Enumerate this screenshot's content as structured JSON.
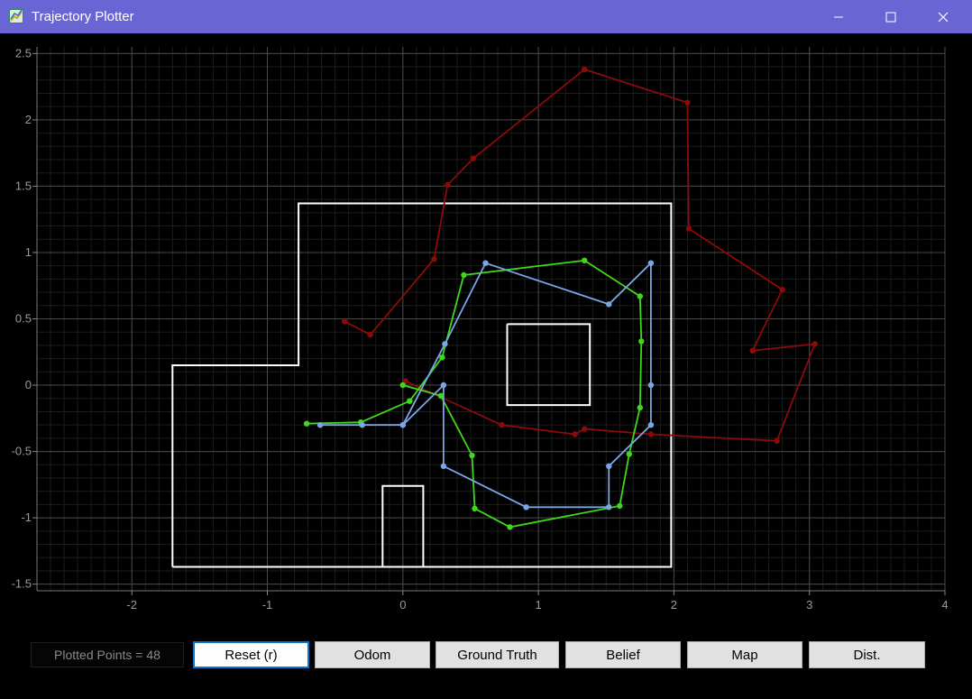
{
  "window": {
    "title": "Trajectory Plotter",
    "minimize_label": "–",
    "maximize_label": "☐",
    "close_label": "✕",
    "titlebar_color": "#6a65d4"
  },
  "counter": {
    "label": "Plotted Points = 48"
  },
  "buttons": {
    "reset": "Reset (r)",
    "odom": "Odom",
    "ground_truth": "Ground Truth",
    "belief": "Belief",
    "map": "Map",
    "dist": "Dist."
  },
  "chart_data": {
    "type": "line",
    "xlim": [
      -2.7,
      4.0
    ],
    "ylim": [
      -1.55,
      2.55
    ],
    "x_ticks": [
      -2,
      -1,
      0,
      1,
      2,
      3,
      4
    ],
    "y_ticks": [
      2.5,
      2,
      1.5,
      1,
      0.5,
      0,
      -0.5,
      -1,
      -1.5
    ],
    "x_tick_labels": [
      "-2",
      "-1",
      "0",
      "1",
      "2",
      "3",
      "4"
    ],
    "y_tick_labels": [
      "2.5",
      "2",
      "1.5",
      "1",
      "0.5",
      "0",
      "-0.5",
      "-1",
      "-1.5"
    ],
    "grid": true,
    "map_segments": [
      [
        [
          -1.7,
          -1.37
        ],
        [
          1.98,
          -1.37
        ],
        [
          1.98,
          1.37
        ],
        [
          -0.77,
          1.37
        ],
        [
          -0.77,
          0.15
        ],
        [
          -1.7,
          0.15
        ],
        [
          -1.7,
          -1.37
        ]
      ],
      [
        [
          0.77,
          0.46
        ],
        [
          1.38,
          0.46
        ],
        [
          1.38,
          -0.15
        ],
        [
          0.77,
          -0.15
        ],
        [
          0.77,
          0.46
        ]
      ],
      [
        [
          -0.15,
          -1.37
        ],
        [
          -0.15,
          -0.76
        ],
        [
          0.15,
          -0.76
        ],
        [
          0.15,
          -1.37
        ]
      ]
    ],
    "series": [
      {
        "color": "#8b0a0a",
        "points": [
          [
            0.02,
            0.03
          ],
          [
            0.73,
            -0.3
          ],
          [
            1.27,
            -0.37
          ],
          [
            1.34,
            -0.33
          ],
          [
            1.83,
            -0.37
          ],
          [
            2.76,
            -0.42
          ],
          [
            3.04,
            0.31
          ],
          [
            2.58,
            0.26
          ],
          [
            2.8,
            0.72
          ],
          [
            2.11,
            1.18
          ],
          [
            2.1,
            2.13
          ],
          [
            1.34,
            2.38
          ],
          [
            0.52,
            1.71
          ],
          [
            0.33,
            1.51
          ],
          [
            0.23,
            0.95
          ],
          [
            -0.24,
            0.38
          ],
          [
            -0.43,
            0.48
          ]
        ]
      },
      {
        "color": "#3fd81a",
        "points": [
          [
            -0.71,
            -0.29
          ],
          [
            -0.31,
            -0.28
          ],
          [
            0.05,
            -0.12
          ],
          [
            0.29,
            0.21
          ],
          [
            0.45,
            0.83
          ],
          [
            1.34,
            0.94
          ],
          [
            1.75,
            0.67
          ],
          [
            1.76,
            0.33
          ],
          [
            1.75,
            -0.17
          ],
          [
            1.67,
            -0.52
          ],
          [
            1.6,
            -0.91
          ],
          [
            0.79,
            -1.07
          ],
          [
            0.53,
            -0.93
          ],
          [
            0.51,
            -0.53
          ],
          [
            0.28,
            -0.08
          ],
          [
            0.0,
            0.0
          ]
        ]
      },
      {
        "color": "#7aa6e8",
        "points": [
          [
            -0.61,
            -0.3
          ],
          [
            -0.3,
            -0.3
          ],
          [
            0.0,
            -0.3
          ],
          [
            0.31,
            0.31
          ],
          [
            0.61,
            0.92
          ],
          [
            1.52,
            0.61
          ],
          [
            1.83,
            0.92
          ],
          [
            1.83,
            0.0
          ],
          [
            1.83,
            -0.3
          ],
          [
            1.52,
            -0.61
          ],
          [
            1.52,
            -0.92
          ],
          [
            0.91,
            -0.92
          ],
          [
            0.3,
            -0.61
          ],
          [
            0.3,
            0.0
          ],
          [
            0.0,
            -0.3
          ]
        ]
      }
    ]
  }
}
